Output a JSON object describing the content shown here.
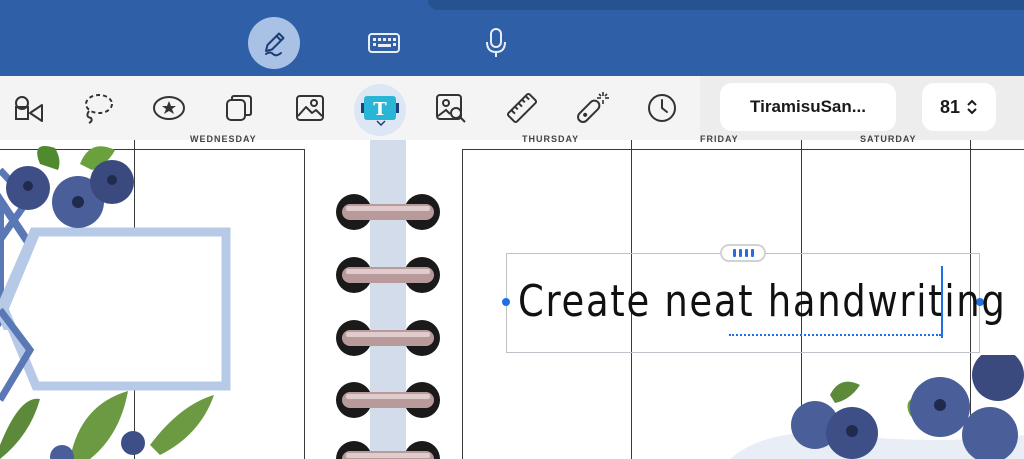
{
  "top_bar": {
    "modes": [
      {
        "icon": "pen-icon",
        "active": true
      },
      {
        "icon": "keyboard-icon",
        "active": false
      },
      {
        "icon": "microphone-icon",
        "active": false
      }
    ]
  },
  "toolbar": {
    "tools": [
      {
        "icon": "shapes-icon"
      },
      {
        "icon": "lasso-icon"
      },
      {
        "icon": "sticker-icon"
      },
      {
        "icon": "elements-icon"
      },
      {
        "icon": "image-icon"
      },
      {
        "icon": "text-tool-icon",
        "active": true
      },
      {
        "icon": "scan-image-icon"
      },
      {
        "icon": "ruler-icon"
      },
      {
        "icon": "laser-pointer-icon"
      },
      {
        "icon": "recent-icon"
      }
    ],
    "font_name": "TiramisuSan...",
    "font_size": "81"
  },
  "planner": {
    "day_headers": [
      "WEDNESDAY",
      "THURSDAY",
      "FRIDAY",
      "SATURDAY"
    ]
  },
  "text_box": {
    "text": "Create neat handwriting"
  },
  "colors": {
    "top_bar": "#2f5fa6",
    "accent": "#1f6fe5",
    "active_mode_bg": "#a9c1e4"
  }
}
